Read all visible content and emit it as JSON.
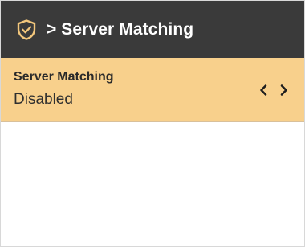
{
  "header": {
    "title": "> Server Matching",
    "icon": "shield-check-icon",
    "background": "#3a3a3a"
  },
  "setting": {
    "label": "Server Matching",
    "value": "Disabled",
    "background": "#f8d08c",
    "prev_icon": "chevron-left-icon",
    "next_icon": "chevron-right-icon"
  }
}
